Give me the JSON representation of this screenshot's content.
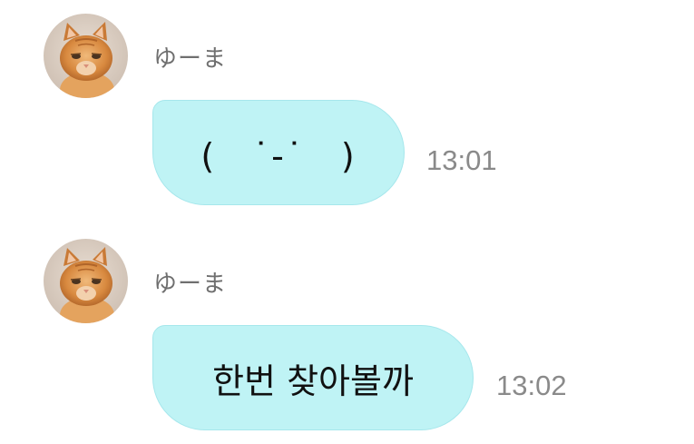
{
  "messages": [
    {
      "sender": "ゆーま",
      "text": "(　˙-˙　)",
      "time": "13:01",
      "avatar_icon": "cat-avatar-icon"
    },
    {
      "sender": "ゆーま",
      "text": "한번 찾아볼까",
      "time": "13:02",
      "avatar_icon": "cat-avatar-icon"
    }
  ],
  "colors": {
    "bubble_bg": "#bff3f5",
    "bubble_border": "#a6e7ec",
    "sender_text": "#6f6f6f",
    "time_text": "#8a8a8a"
  }
}
